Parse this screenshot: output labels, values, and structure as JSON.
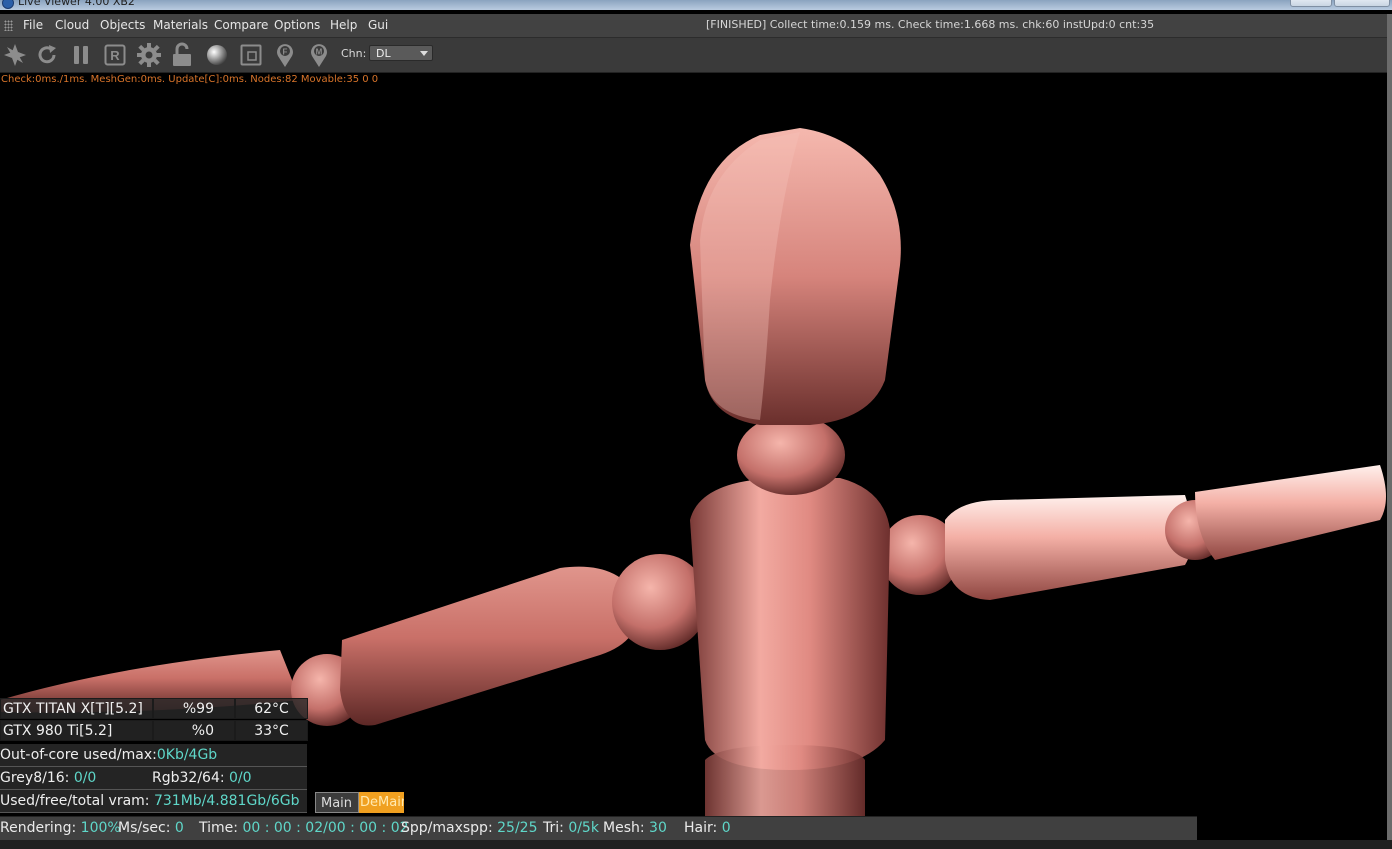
{
  "window": {
    "title": "Live Viewer 4.00 XB2"
  },
  "menu": {
    "items": [
      "File",
      "Cloud",
      "Objects",
      "Materials",
      "Compare",
      "Options",
      "Help",
      "Gui"
    ],
    "status": "[FINISHED] Collect time:0.159 ms.  Check time:1.668 ms.  chk:60  instUpd:0  cnt:35"
  },
  "toolbar": {
    "icons": [
      "render-settings-icon",
      "refresh-icon",
      "pause-icon",
      "region-render-icon",
      "settings-gear-icon",
      "lock-icon",
      "material-sphere-icon",
      "frame-icon",
      "pin-f-icon",
      "pin-m-icon"
    ],
    "channel_label": "Chn:",
    "channel_value": "DL"
  },
  "info_line": "Check:0ms./1ms. MeshGen:0ms. Update[C]:0ms. Nodes:82 Movable:35  0 0",
  "gpus": [
    {
      "name": "GTX TITAN X[T][5.2]",
      "usage": "%99",
      "temp": "62°C"
    },
    {
      "name": "GTX 980 Ti[5.2]",
      "usage": "%0",
      "temp": "33°C"
    }
  ],
  "stats": {
    "outofcore_label": "Out-of-core used/max:",
    "outofcore_value": "0Kb/4Gb",
    "grey_label": "Grey8/16: ",
    "grey_value": "0/0",
    "rgb_label": "Rgb32/64: ",
    "rgb_value": "0/0",
    "vram_label": "Used/free/total vram: ",
    "vram_value": "731Mb/4.881Gb/6Gb"
  },
  "tabs": {
    "main": "Main",
    "demain": "DeMain"
  },
  "status_bar": {
    "rendering_label": "Rendering: ",
    "rendering_value": "100%",
    "mssec_label": "Ms/sec: ",
    "mssec_value": "0",
    "time_label": "Time: ",
    "time_value": "00 : 00 : 02/00 : 00 : 02",
    "spp_label": "Spp/maxspp: ",
    "spp_value": "25/25",
    "tri_label": "Tri: ",
    "tri_value": "0/5k",
    "mesh_label": "Mesh: ",
    "mesh_value": "30",
    "hair_label": "Hair: ",
    "hair_value": "0"
  },
  "colors": {
    "accent_value": "#5fd7c9",
    "info_orange": "#d8742a",
    "figure_skin": "#e9948c",
    "tab_active": "#f0a020"
  }
}
